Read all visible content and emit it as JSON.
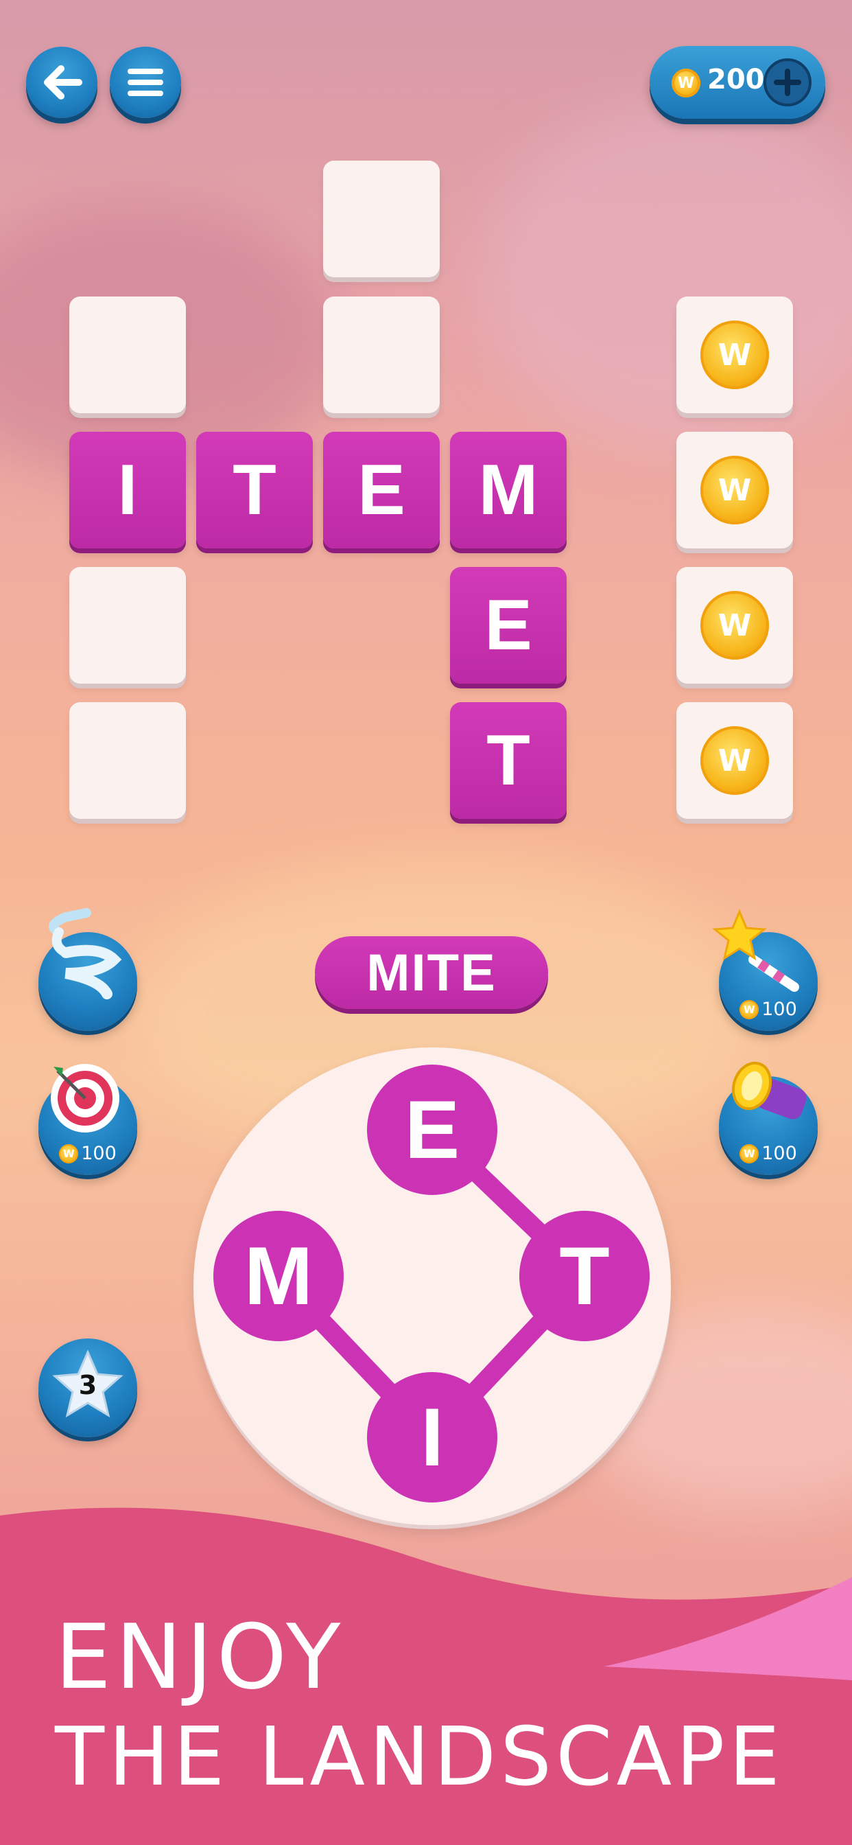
{
  "header": {
    "back_icon": "arrow-left-icon",
    "menu_icon": "hamburger-menu-icon",
    "coins": "200",
    "coin_symbol": "W",
    "add_icon": "plus-icon"
  },
  "grid": {
    "words": [
      "ITEM",
      "MET"
    ],
    "letters": {
      "i": "I",
      "t": "T",
      "e": "E",
      "m": "M",
      "e2": "E",
      "t2": "T"
    },
    "bonus_coin_symbol": "W"
  },
  "preview_word": "MITE",
  "powerups": {
    "shuffle_icon": "shuffle-icon",
    "target": {
      "icon": "target-icon",
      "cost": "100"
    },
    "magic_wand": {
      "icon": "magic-wand-icon",
      "cost": "100"
    },
    "flashlight": {
      "icon": "flashlight-icon",
      "cost": "100"
    },
    "stars": {
      "icon": "star-icon",
      "count": "3"
    }
  },
  "wheel": {
    "letters": {
      "top": "E",
      "left": "M",
      "right": "T",
      "bottom": "I"
    }
  },
  "banner": {
    "line1": "ENJOY",
    "line2": "THE LANDSCAPE"
  },
  "colors": {
    "tile_filled": "#cc33b4",
    "button_blue": "#1e7fc0",
    "banner": "#dd4f7c",
    "coin_gold": "#f7b51a"
  }
}
